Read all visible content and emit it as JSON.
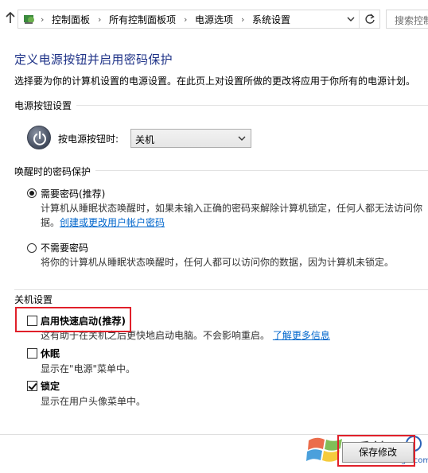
{
  "address_bar": {
    "crumbs": [
      "控制面板",
      "所有控制面板项",
      "电源选项",
      "系统设置"
    ],
    "search_placeholder": "搜索控制"
  },
  "page": {
    "title": "定义电源按钮并启用密码保护",
    "subtitle": "选择要为你的计算机设置的电源设置。在此页上对设置所做的更改将应用于你所有的电源计划。"
  },
  "power_button_settings": {
    "heading": "电源按钮设置",
    "label": "按电源按钮时:",
    "selected": "关机"
  },
  "wake_password": {
    "heading": "唤醒时的密码保护",
    "option_require": {
      "label": "需要密码(推荐)",
      "selected": true,
      "desc_line1": "计算机从睡眠状态唤醒时，如果未输入正确的密码来解除计算机锁定，任何人都无法访问你",
      "desc_line2_prefix": "据。",
      "link": "创建或更改用户帐户密码"
    },
    "option_no": {
      "label": "不需要密码",
      "selected": false,
      "desc": "将你的计算机从睡眠状态唤醒时，任何人都可以访问你的数据，因为计算机未锁定。"
    }
  },
  "shutdown_settings": {
    "heading": "关机设置",
    "fast_startup": {
      "label": "启用快速启动(推荐)",
      "checked": false,
      "desc": "这有助于在关机之后更快地启动电脑。不会影响重启。",
      "link": "了解更多信息"
    },
    "hibernate": {
      "label": "休眠",
      "checked": false,
      "desc": "显示在\"电源\"菜单中。"
    },
    "lock": {
      "label": "锁定",
      "checked": true,
      "desc": "显示在用户头像菜单中。"
    }
  },
  "footer": {
    "save_label": "保存修改"
  },
  "watermark": {
    "text": "系统",
    "url": "www.xitong8.com"
  },
  "colors": {
    "title": "#1e3287",
    "link": "#0066cc",
    "highlight": "#e0202a"
  }
}
